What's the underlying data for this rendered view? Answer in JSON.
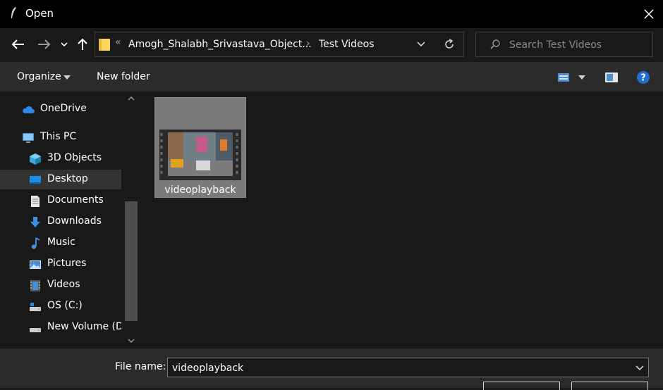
{
  "window": {
    "title": "Open"
  },
  "address": {
    "overflow_chevron": "«",
    "crumbs": [
      "Amogh_Shalabh_Srivastava_Object...",
      "Test Videos"
    ],
    "separator": "›"
  },
  "search": {
    "placeholder": "Search Test Videos"
  },
  "toolbar": {
    "organize_label": "Organize",
    "new_folder_label": "New folder"
  },
  "sidebar": {
    "items": [
      {
        "label": "OneDrive",
        "icon": "cloud-icon"
      },
      {
        "label": "This PC",
        "icon": "computer-icon"
      },
      {
        "label": "3D Objects",
        "icon": "cube-icon"
      },
      {
        "label": "Desktop",
        "icon": "desktop-icon",
        "selected": true
      },
      {
        "label": "Documents",
        "icon": "document-icon"
      },
      {
        "label": "Downloads",
        "icon": "download-icon"
      },
      {
        "label": "Music",
        "icon": "music-icon"
      },
      {
        "label": "Pictures",
        "icon": "pictures-icon"
      },
      {
        "label": "Videos",
        "icon": "videos-icon"
      },
      {
        "label": "OS (C:)",
        "icon": "drive-icon"
      },
      {
        "label": "New Volume (D:)",
        "icon": "drive-icon"
      }
    ]
  },
  "files": [
    {
      "name": "videoplayback",
      "type": "video"
    }
  ],
  "bottom": {
    "file_name_label": "File name:",
    "file_name_value": "videoplayback"
  },
  "colors": {
    "accent": "#0078d7",
    "folder": "#ffd65c",
    "selected_tile": "#7a7a7a"
  }
}
